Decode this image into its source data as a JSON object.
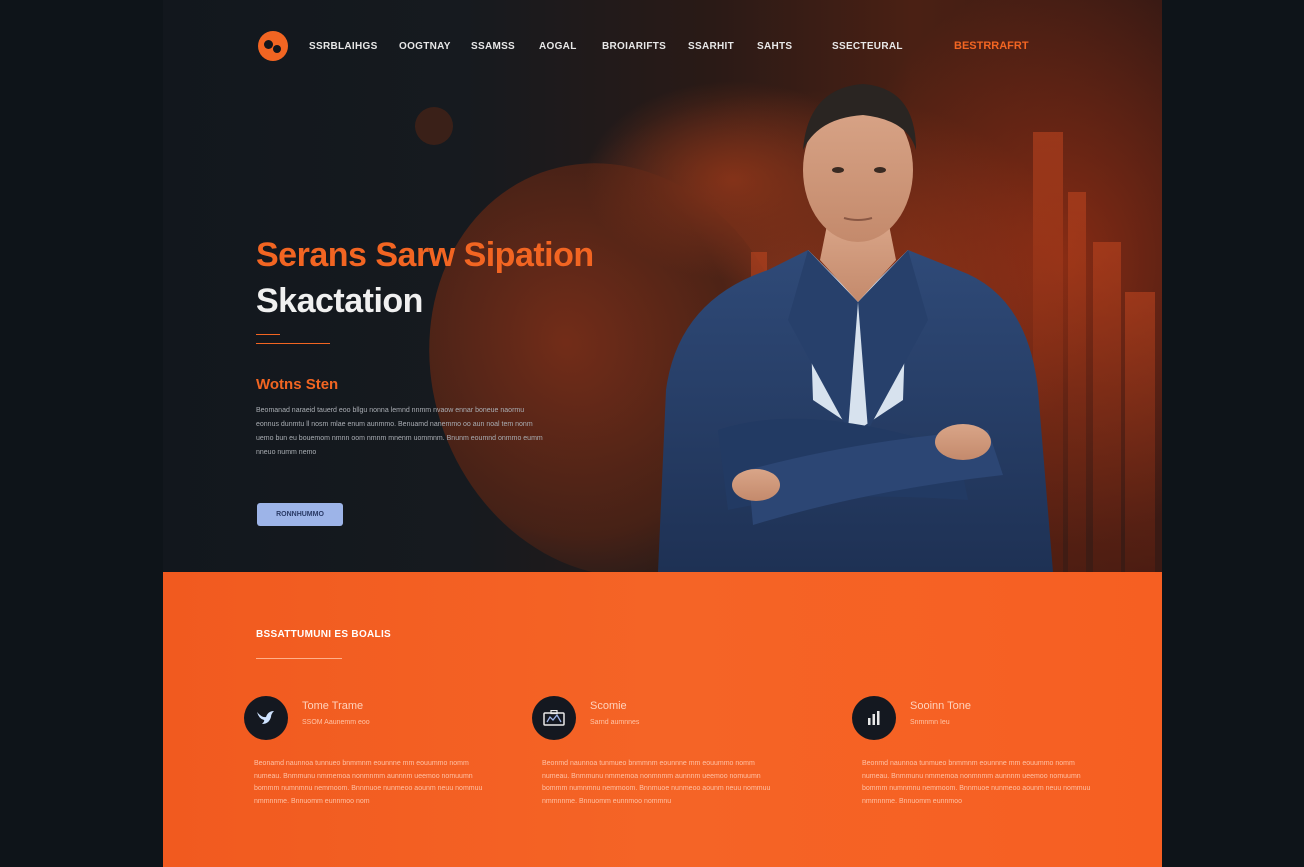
{
  "nav": {
    "items": [
      "SSRBLAIHGS",
      "OOGTNAY",
      "SSAMSS",
      "AOGAL",
      "BROIARIFTS",
      "SSARHIT",
      "SAHTS",
      "SSECTEURAL"
    ],
    "cta": "BESTRRAFRT"
  },
  "hero": {
    "title_line1": "Serans Sarw Sipation",
    "title_line2": "Skactation",
    "subtitle": "Wotns Sten",
    "paragraph": "Beomanad naraeid tauerd eoo bllgu nonna lemnd nnmm nvaow ennar boneue naormu eonnus dunmtu ll nosm mlae enum aunmmo. Benuamd nanemmo oo aun noal tem nonm uemo bun eu bouemom nmnn oom nmnm mnenm uommnm. Bnunm eoumnd onmmo eumm nneuo numm nemo",
    "button_label": "RONNHUMMO"
  },
  "services": {
    "section_title": "BSSATTUMUNI ES BOALIS",
    "cards": [
      {
        "icon": "bird-icon",
        "title": "Tome Trame",
        "subtitle": "SSOM Aaunemm eoo",
        "body": "Beonamd naunnoa tunnueo bnmmnm eounnne mm eouummo nomm numeau. Bnmmunu nmmemoa nonmnmm aunnnm ueemoo nomuumn bommm numnmnu nemmoom. Bnnmuoe nunmeoo aounm neuu nommuu nmmnnme. Bnnuomm eunnmoo nom"
      },
      {
        "icon": "briefcase-icon",
        "title": "Scomie",
        "subtitle": "Sarnd aumnnes",
        "body": "Beonmd naunnoa tunmueo bnmmnm eounnne mm eouummo nomm numeau. Bnmmunu nmmemoa nonmnmm aunnnm ueemoo nomuumn bommm numnmnu nemmoom. Bnnmuoe nunmeoo aounm neuu nommuu nmmnnme. Bnnuomm eunnmoo nommnu"
      },
      {
        "icon": "bar-chart-icon",
        "title": "Sooinn Tone",
        "subtitle": "Snmnmn Ieu",
        "body": "Beonmd naunnoa tunmueo bnmmnm eounnne mm eouummo nomm numeau. Bnmmunu nmmemoa nonmnmm aunnnm ueemoo nomuumn bommm numnmnu nemmoom. Bnnmuoe nunmeoo aounm neuu nommuu nmmnnme. Bnnuomm eunnmoo"
      }
    ]
  },
  "colors": {
    "accent": "#f26522",
    "dark": "#12161c",
    "button": "#9db4e8"
  }
}
